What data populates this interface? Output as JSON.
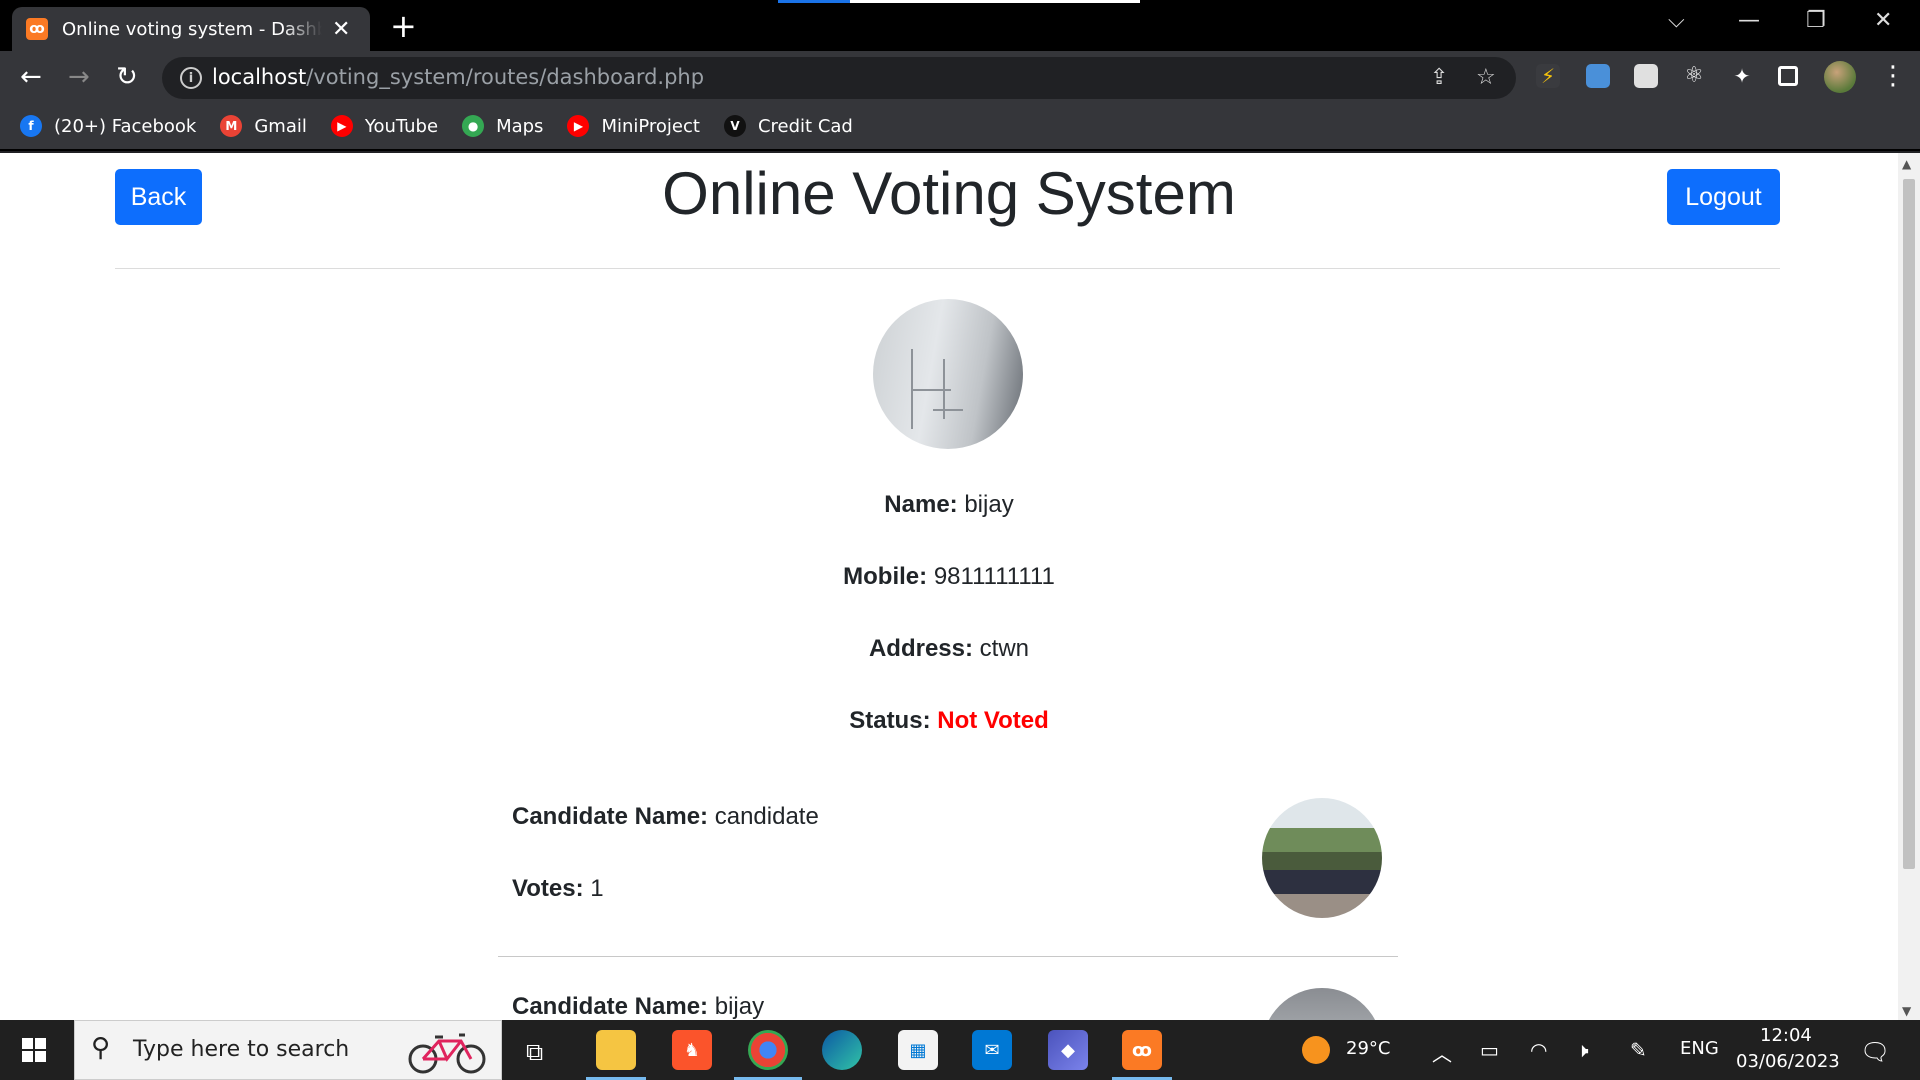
{
  "browser": {
    "tab_title": "Online voting system - Dashboard",
    "tab_favicon": "xampp-icon",
    "url_host": "localhost",
    "url_path": "/voting_system/routes/dashboard.php",
    "bookmarks": [
      {
        "label": "(20+) Facebook",
        "icon": "facebook-icon",
        "color": "#1877f2",
        "glyph": "f"
      },
      {
        "label": "Gmail",
        "icon": "gmail-icon",
        "color": "#ea4335",
        "glyph": "M"
      },
      {
        "label": "YouTube",
        "icon": "youtube-icon",
        "color": "#ff0000",
        "glyph": "▶"
      },
      {
        "label": "Maps",
        "icon": "maps-icon",
        "color": "#34a853",
        "glyph": "●"
      },
      {
        "label": "MiniProject",
        "icon": "youtube-icon",
        "color": "#ff0000",
        "glyph": "▶"
      },
      {
        "label": "Credit Cad",
        "icon": "v-logo-icon",
        "color": "#111111",
        "glyph": "V"
      }
    ]
  },
  "header": {
    "back_label": "Back",
    "title": "Online Voting System",
    "logout_label": "Logout"
  },
  "profile": {
    "name_label": "Name:",
    "name": "bijay",
    "mobile_label": "Mobile:",
    "mobile": "9811111111",
    "address_label": "Address:",
    "address": "ctwn",
    "status_label": "Status:",
    "status": "Not Voted",
    "status_color": "#ff0000"
  },
  "candidates": [
    {
      "name_label": "Candidate Name:",
      "name": "candidate",
      "votes_label": "Votes:",
      "votes": "1"
    },
    {
      "name_label": "Candidate Name:",
      "name": "bijay"
    }
  ],
  "taskbar": {
    "search_placeholder": "Type here to search",
    "weather": "29°C",
    "language": "ENG",
    "time": "12:04",
    "date": "03/06/2023"
  },
  "colors": {
    "primary_button": "#0d6efd",
    "not_voted": "#ff0000"
  }
}
